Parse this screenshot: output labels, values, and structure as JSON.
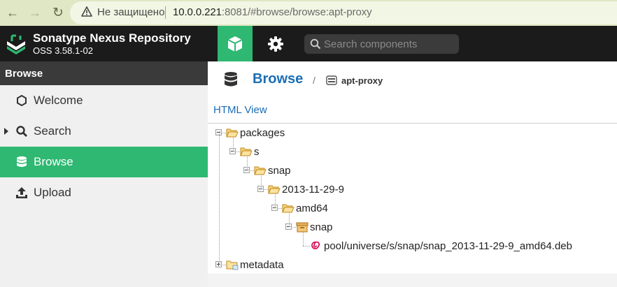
{
  "browser": {
    "security_label": "Не защищено",
    "url_host": "10.0.0.221",
    "url_rest": ":8081/#browse/browse:apt-proxy"
  },
  "header": {
    "app_name": "Sonatype Nexus Repository",
    "app_version": "OSS 3.58.1-02",
    "search_placeholder": "Search components",
    "accent_color": "#2eb872"
  },
  "sidebar": {
    "title": "Browse",
    "items": [
      {
        "label": "Welcome",
        "icon": "hexagon-icon"
      },
      {
        "label": "Search",
        "icon": "magnifier-icon"
      },
      {
        "label": "Browse",
        "icon": "database-icon",
        "active": true
      },
      {
        "label": "Upload",
        "icon": "upload-icon"
      }
    ]
  },
  "main": {
    "breadcrumb_root": "Browse",
    "breadcrumb_sep": "/",
    "breadcrumb_repo": "apt-proxy",
    "html_view": "HTML View",
    "tree": [
      {
        "label": "packages",
        "depth": 0,
        "type": "folder",
        "expanded": true
      },
      {
        "label": "s",
        "depth": 1,
        "type": "folder",
        "expanded": true
      },
      {
        "label": "snap",
        "depth": 2,
        "type": "folder",
        "expanded": true
      },
      {
        "label": "2013-11-29-9",
        "depth": 3,
        "type": "folder",
        "expanded": true
      },
      {
        "label": "amd64",
        "depth": 4,
        "type": "folder",
        "expanded": true
      },
      {
        "label": "snap",
        "depth": 5,
        "type": "component",
        "expanded": true
      },
      {
        "label": "pool/universe/s/snap/snap_2013-11-29-9_amd64.deb",
        "depth": 6,
        "type": "debian-asset"
      },
      {
        "label": "metadata",
        "depth": 0,
        "type": "folder",
        "expanded": false
      }
    ]
  }
}
